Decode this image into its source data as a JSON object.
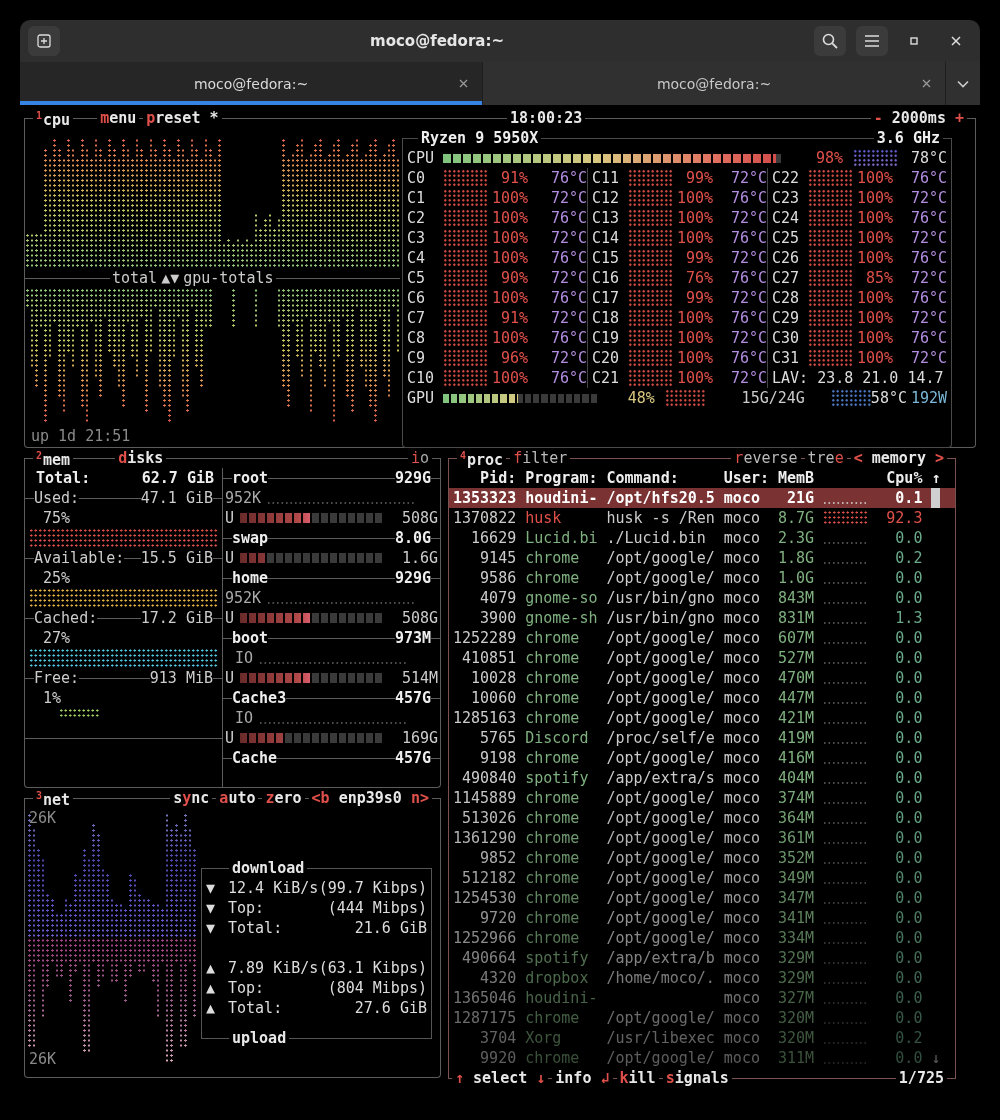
{
  "window": {
    "title": "moco@fedora:~"
  },
  "tabs": [
    {
      "label": "moco@fedora:~",
      "selected": true
    },
    {
      "label": "moco@fedora:~",
      "selected": false
    }
  ],
  "cpu": {
    "number": "1",
    "title": "cpu",
    "menu": [
      {
        "text": "m",
        "hotkey": true
      },
      {
        "text": "enu",
        "hotkey": false
      }
    ],
    "preset": [
      {
        "text": "p",
        "hotkey": true
      },
      {
        "text": "reset *",
        "hotkey": false
      }
    ],
    "clock": "18:00:23",
    "interval": [
      {
        "text": "-",
        "hotkey": true
      },
      {
        "text": " 2000ms ",
        "hotkey": false
      },
      {
        "text": "+",
        "hotkey": true
      }
    ],
    "graph_upper_label": "total",
    "graph_toggle": "▲▼",
    "graph_lower_label": "gpu-totals",
    "uptime": "up 1d 21:51",
    "model": "Ryzen 9 5950X",
    "frequency": "3.6 GHz",
    "total": {
      "label": "CPU",
      "level": 0.98,
      "percent": "98%",
      "temp": "78°C"
    },
    "cores": [
      {
        "name": "C0",
        "percent": "91%",
        "temp": "76°C"
      },
      {
        "name": "C1",
        "percent": "100%",
        "temp": "72°C"
      },
      {
        "name": "C2",
        "percent": "100%",
        "temp": "76°C"
      },
      {
        "name": "C3",
        "percent": "100%",
        "temp": "72°C"
      },
      {
        "name": "C4",
        "percent": "100%",
        "temp": "76°C"
      },
      {
        "name": "C5",
        "percent": "90%",
        "temp": "72°C"
      },
      {
        "name": "C6",
        "percent": "100%",
        "temp": "76°C"
      },
      {
        "name": "C7",
        "percent": "91%",
        "temp": "72°C"
      },
      {
        "name": "C8",
        "percent": "100%",
        "temp": "76°C"
      },
      {
        "name": "C9",
        "percent": "96%",
        "temp": "72°C"
      },
      {
        "name": "C10",
        "percent": "100%",
        "temp": "76°C"
      },
      {
        "name": "C11",
        "percent": "99%",
        "temp": "72°C"
      },
      {
        "name": "C12",
        "percent": "100%",
        "temp": "76°C"
      },
      {
        "name": "C13",
        "percent": "100%",
        "temp": "72°C"
      },
      {
        "name": "C14",
        "percent": "100%",
        "temp": "76°C"
      },
      {
        "name": "C15",
        "percent": "99%",
        "temp": "72°C"
      },
      {
        "name": "C16",
        "percent": "76%",
        "temp": "76°C"
      },
      {
        "name": "C17",
        "percent": "99%",
        "temp": "72°C"
      },
      {
        "name": "C18",
        "percent": "100%",
        "temp": "76°C"
      },
      {
        "name": "C19",
        "percent": "100%",
        "temp": "72°C"
      },
      {
        "name": "C20",
        "percent": "100%",
        "temp": "76°C"
      },
      {
        "name": "C21",
        "percent": "100%",
        "temp": "72°C"
      },
      {
        "name": "C22",
        "percent": "100%",
        "temp": "76°C"
      },
      {
        "name": "C23",
        "percent": "100%",
        "temp": "72°C"
      },
      {
        "name": "C24",
        "percent": "100%",
        "temp": "76°C"
      },
      {
        "name": "C25",
        "percent": "100%",
        "temp": "72°C"
      },
      {
        "name": "C26",
        "percent": "100%",
        "temp": "76°C"
      },
      {
        "name": "C27",
        "percent": "85%",
        "temp": "72°C"
      },
      {
        "name": "C28",
        "percent": "100%",
        "temp": "76°C"
      },
      {
        "name": "C29",
        "percent": "100%",
        "temp": "72°C"
      },
      {
        "name": "C30",
        "percent": "100%",
        "temp": "76°C"
      },
      {
        "name": "C31",
        "percent": "100%",
        "temp": "72°C"
      }
    ],
    "load": {
      "label": "LAV:",
      "values": [
        "23.8",
        "21.0",
        "14.7"
      ]
    },
    "gpu": {
      "label": "GPU",
      "level": 0.48,
      "percent": "48%",
      "memory": "15G/24G",
      "temp": "58°C",
      "power": "192W"
    }
  },
  "mem": {
    "number": "2",
    "title": "mem",
    "total": {
      "label": "Total:",
      "value": "62.7 GiB"
    },
    "items": [
      {
        "label": "Used:",
        "value": "47.1 GiB",
        "percent": "75%",
        "color": "#e0504a"
      },
      {
        "label": "Available:",
        "value": "15.5 GiB",
        "percent": "25%",
        "color": "#e0b040"
      },
      {
        "label": "Cached:",
        "value": "17.2 GiB",
        "percent": "27%",
        "color": "#50c8e0"
      },
      {
        "label": "Free:",
        "value": "913 MiB",
        "percent": "1%",
        "color": "#a0d060"
      }
    ]
  },
  "disks": {
    "title": [
      {
        "text": "d",
        "hotkey": true
      },
      {
        "text": "isks",
        "hotkey": false
      }
    ],
    "io": [
      {
        "text": "i",
        "hotkey": true
      },
      {
        "text": "o",
        "hotkey": false
      }
    ],
    "items": [
      {
        "name": "root",
        "size": "929G",
        "io": "952K",
        "used_label": "U",
        "level": 0.5,
        "used": "508G"
      },
      {
        "name": "swap",
        "size": "8.0G",
        "used_label": "U",
        "level": 0.19,
        "used": "1.6G"
      },
      {
        "name": "home",
        "size": "929G",
        "io": "952K",
        "used_label": "U",
        "level": 0.5,
        "used": "508G"
      },
      {
        "name": "boot",
        "size": "973M",
        "io": "IO",
        "used_label": "U",
        "level": 0.5,
        "used": "514M"
      },
      {
        "name": "Cache3",
        "size": "457G",
        "io": "IO",
        "used_label": "U",
        "level": 0.31,
        "used": "169G"
      },
      {
        "name": "Cache",
        "size": "457G"
      }
    ]
  },
  "net": {
    "number": "3",
    "title": "net",
    "buttons": [
      [
        {
          "text": "s",
          "hotkey": false
        },
        {
          "text": "y",
          "hotkey": true
        },
        {
          "text": "nc",
          "hotkey": false
        }
      ],
      [
        {
          "text": "a",
          "hotkey": true
        },
        {
          "text": "uto",
          "hotkey": false
        }
      ],
      [
        {
          "text": "z",
          "hotkey": true
        },
        {
          "text": "ero",
          "hotkey": false
        }
      ]
    ],
    "interface": {
      "previous": "<b",
      "name": "enp39s0",
      "next": "n>"
    },
    "scale_top": "26K",
    "scale_bottom": "26K",
    "download": {
      "title": "download",
      "rows": [
        {
          "arrow": "▼",
          "label": "12.4 KiB/s",
          "value": "(99.7 Kibps)"
        },
        {
          "arrow": "▼",
          "label": "Top:",
          "value": "(444 Mibps)"
        },
        {
          "arrow": "▼",
          "label": "Total:",
          "value": "21.6 GiB"
        }
      ]
    },
    "upload": {
      "title": "upload",
      "rows": [
        {
          "arrow": "▲",
          "label": "7.89 KiB/s",
          "value": "(63.1 Kibps)"
        },
        {
          "arrow": "▲",
          "label": "Top:",
          "value": "(804 Mibps)"
        },
        {
          "arrow": "▲",
          "label": "Total:",
          "value": "27.6 GiB"
        }
      ]
    }
  },
  "proc": {
    "number": "4",
    "title": "proc",
    "filter": [
      {
        "text": "f",
        "hotkey": true
      },
      {
        "text": "ilter",
        "hotkey": false
      }
    ],
    "reverse": [
      {
        "text": "r",
        "hotkey": true
      },
      {
        "text": "everse",
        "hotkey": false
      }
    ],
    "tree": [
      {
        "text": "tre",
        "hotkey": false
      },
      {
        "text": "e",
        "hotkey": true
      }
    ],
    "sort": {
      "previous": "<",
      "name": "memory",
      "next": ">"
    },
    "columns": [
      "Pid:",
      "Program:",
      "Command:",
      "User:",
      "MemB",
      "Cpu%"
    ],
    "scroll_up": "↑",
    "scroll_down": "↓",
    "rows": [
      {
        "pid": "1353323",
        "program": "houdini-",
        "command": "/opt/hfs20.5",
        "user": "moco",
        "mem": "21G",
        "cpu": "0.1",
        "selected": true,
        "hot": false
      },
      {
        "pid": "1370822",
        "program": "husk",
        "command": "husk -s /Ren",
        "user": "moco",
        "mem": "8.7G",
        "cpu": "92.3",
        "selected": false,
        "hot": true
      },
      {
        "pid": "16629",
        "program": "Lucid.bi",
        "command": "./Lucid.bin",
        "user": "moco",
        "mem": "2.3G",
        "cpu": "0.0",
        "selected": false,
        "hot": false
      },
      {
        "pid": "9145",
        "program": "chrome",
        "command": "/opt/google/",
        "user": "moco",
        "mem": "1.8G",
        "cpu": "0.2",
        "selected": false,
        "hot": false
      },
      {
        "pid": "9586",
        "program": "chrome",
        "command": "/opt/google/",
        "user": "moco",
        "mem": "1.0G",
        "cpu": "0.0",
        "selected": false,
        "hot": false
      },
      {
        "pid": "4079",
        "program": "gnome-so",
        "command": "/usr/bin/gno",
        "user": "moco",
        "mem": "843M",
        "cpu": "0.0",
        "selected": false,
        "hot": false
      },
      {
        "pid": "3900",
        "program": "gnome-sh",
        "command": "/usr/bin/gno",
        "user": "moco",
        "mem": "831M",
        "cpu": "1.3",
        "selected": false,
        "hot": false
      },
      {
        "pid": "1252289",
        "program": "chrome",
        "command": "/opt/google/",
        "user": "moco",
        "mem": "607M",
        "cpu": "0.0",
        "selected": false,
        "hot": false
      },
      {
        "pid": "410851",
        "program": "chrome",
        "command": "/opt/google/",
        "user": "moco",
        "mem": "527M",
        "cpu": "0.0",
        "selected": false,
        "hot": false
      },
      {
        "pid": "10028",
        "program": "chrome",
        "command": "/opt/google/",
        "user": "moco",
        "mem": "470M",
        "cpu": "0.0",
        "selected": false,
        "hot": false
      },
      {
        "pid": "10060",
        "program": "chrome",
        "command": "/opt/google/",
        "user": "moco",
        "mem": "447M",
        "cpu": "0.0",
        "selected": false,
        "hot": false
      },
      {
        "pid": "1285163",
        "program": "chrome",
        "command": "/opt/google/",
        "user": "moco",
        "mem": "421M",
        "cpu": "0.0",
        "selected": false,
        "hot": false
      },
      {
        "pid": "5765",
        "program": "Discord",
        "command": "/proc/self/e",
        "user": "moco",
        "mem": "419M",
        "cpu": "0.0",
        "selected": false,
        "hot": false
      },
      {
        "pid": "9198",
        "program": "chrome",
        "command": "/opt/google/",
        "user": "moco",
        "mem": "416M",
        "cpu": "0.0",
        "selected": false,
        "hot": false
      },
      {
        "pid": "490840",
        "program": "spotify",
        "command": "/app/extra/s",
        "user": "moco",
        "mem": "404M",
        "cpu": "0.0",
        "selected": false,
        "hot": false
      },
      {
        "pid": "1145889",
        "program": "chrome",
        "command": "/opt/google/",
        "user": "moco",
        "mem": "374M",
        "cpu": "0.0",
        "selected": false,
        "hot": false
      },
      {
        "pid": "513026",
        "program": "chrome",
        "command": "/opt/google/",
        "user": "moco",
        "mem": "364M",
        "cpu": "0.0",
        "selected": false,
        "hot": false
      },
      {
        "pid": "1361290",
        "program": "chrome",
        "command": "/opt/google/",
        "user": "moco",
        "mem": "361M",
        "cpu": "0.0",
        "selected": false,
        "hot": false
      },
      {
        "pid": "9852",
        "program": "chrome",
        "command": "/opt/google/",
        "user": "moco",
        "mem": "352M",
        "cpu": "0.0",
        "selected": false,
        "hot": false
      },
      {
        "pid": "512182",
        "program": "chrome",
        "command": "/opt/google/",
        "user": "moco",
        "mem": "349M",
        "cpu": "0.0",
        "selected": false,
        "hot": false
      },
      {
        "pid": "1254530",
        "program": "chrome",
        "command": "/opt/google/",
        "user": "moco",
        "mem": "347M",
        "cpu": "0.0",
        "selected": false,
        "hot": false
      },
      {
        "pid": "9720",
        "program": "chrome",
        "command": "/opt/google/",
        "user": "moco",
        "mem": "341M",
        "cpu": "0.0",
        "selected": false,
        "hot": false
      },
      {
        "pid": "1252966",
        "program": "chrome",
        "command": "/opt/google/",
        "user": "moco",
        "mem": "334M",
        "cpu": "0.0",
        "selected": false,
        "hot": false
      },
      {
        "pid": "490664",
        "program": "spotify",
        "command": "/app/extra/b",
        "user": "moco",
        "mem": "329M",
        "cpu": "0.0",
        "selected": false,
        "hot": false
      },
      {
        "pid": "4320",
        "program": "dropbox",
        "command": "/home/moco/.",
        "user": "moco",
        "mem": "329M",
        "cpu": "0.0",
        "selected": false,
        "hot": false
      },
      {
        "pid": "1365046",
        "program": "houdini-",
        "user": "moco",
        "mem": "327M",
        "cpu": "0.0",
        "selected": false,
        "hot": false
      },
      {
        "pid": "1287175",
        "program": "chrome",
        "command": "/opt/google/",
        "user": "moco",
        "mem": "320M",
        "cpu": "0.0",
        "selected": false,
        "hot": false
      },
      {
        "pid": "3704",
        "program": "Xorg",
        "command": "/usr/libexec",
        "user": "moco",
        "mem": "320M",
        "cpu": "0.2",
        "selected": false,
        "hot": false
      },
      {
        "pid": "9920",
        "program": "chrome",
        "command": "/opt/google/",
        "user": "moco",
        "mem": "311M",
        "cpu": "0.0",
        "selected": false,
        "hot": false
      }
    ],
    "footer": [
      [
        {
          "text": "↑",
          "hotkey": true
        },
        {
          "text": " select ",
          "hotkey": false
        },
        {
          "text": "↓",
          "hotkey": true
        }
      ],
      [
        {
          "text": "info ",
          "hotkey": false
        },
        {
          "text": "↲",
          "hotkey": true
        }
      ],
      [
        {
          "text": "k",
          "hotkey": true
        },
        {
          "text": "ill",
          "hotkey": false
        }
      ],
      [
        {
          "text": "s",
          "hotkey": true
        },
        {
          "text": "ignals",
          "hotkey": false
        }
      ]
    ],
    "count": "1/725"
  }
}
